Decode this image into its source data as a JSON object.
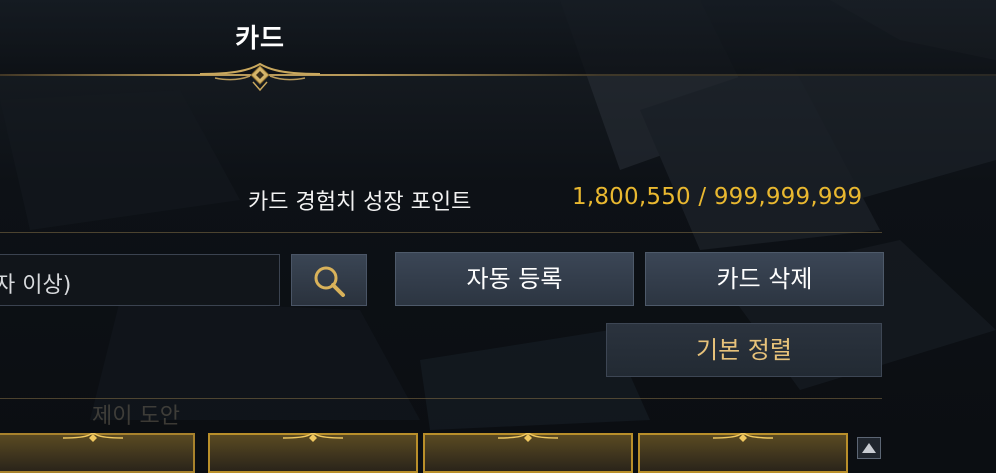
{
  "window": {
    "title": "카드"
  },
  "stats": {
    "exp_label": "카드 경험치 성장 포인트",
    "exp_value": "1,800,550 / 999,999,999"
  },
  "search": {
    "value": "자 이상)",
    "button_icon": "search-icon"
  },
  "buttons": {
    "auto_register": "자동 등록",
    "delete_card": "카드 삭제",
    "sort_default": "기본 정렬"
  },
  "cards": {
    "faded_label": "제이 도안",
    "count_visible": 4
  },
  "colors": {
    "accent_gold": "#e9b830",
    "sort_text": "#e7c27a",
    "frame_gold": "#b98f2a"
  }
}
